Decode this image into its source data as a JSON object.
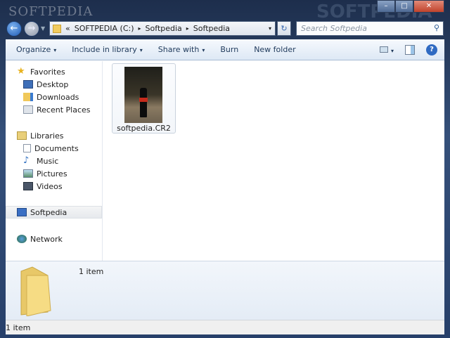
{
  "window": {
    "watermark": "SOFTPEDIA",
    "minimize": "–",
    "maximize": "□",
    "close": "✕"
  },
  "nav": {
    "back_icon": "←",
    "forward_icon": "→"
  },
  "address": {
    "prefix": "«",
    "segments": [
      "SOFTPEDIA (C:)",
      "Softpedia",
      "Softpedia"
    ],
    "separator": "▸",
    "dropdown": "▾",
    "refresh": "↻"
  },
  "search": {
    "placeholder": "Search Softpedia",
    "icon": "⚲"
  },
  "toolbar": {
    "items": [
      {
        "label": "Organize",
        "caret": "▾"
      },
      {
        "label": "Include in library",
        "caret": "▾"
      },
      {
        "label": "Share with",
        "caret": "▾"
      },
      {
        "label": "Burn"
      },
      {
        "label": "New folder"
      }
    ],
    "view_caret": "▾",
    "help": "?"
  },
  "sidebar": {
    "favorites": {
      "label": "Favorites",
      "items": [
        "Desktop",
        "Downloads",
        "Recent Places"
      ]
    },
    "libraries": {
      "label": "Libraries",
      "items": [
        "Documents",
        "Music",
        "Pictures",
        "Videos"
      ]
    },
    "computer": "Softpedia",
    "network": "Network"
  },
  "files": [
    {
      "name": "softpedia.CR2"
    }
  ],
  "details": {
    "count": "1 item"
  },
  "status": {
    "count": "1 item"
  }
}
